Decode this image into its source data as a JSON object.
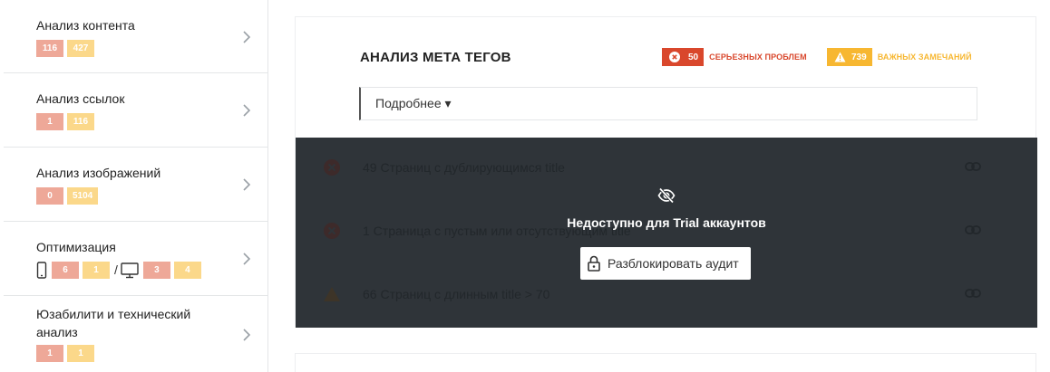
{
  "sidebar": {
    "items": [
      {
        "title": "Анализ контента",
        "badges": [
          "116",
          "427"
        ]
      },
      {
        "title": "Анализ ссылок",
        "badges": [
          "1",
          "116"
        ]
      },
      {
        "title": "Анализ изображений",
        "badges": [
          "0",
          "5104"
        ]
      },
      {
        "title": "Оптимизация",
        "mobile": [
          "6",
          "1"
        ],
        "separator": "/",
        "desktop": [
          "3",
          "4"
        ]
      },
      {
        "title": "Юзабилити и технический анализ",
        "badges": [
          "1",
          "1"
        ]
      }
    ]
  },
  "main": {
    "title": "АНАЛИЗ МЕТА ТЕГОВ",
    "errors": {
      "count": "50",
      "label": "СЕРЬЕЗНЫХ ПРОБЛЕМ"
    },
    "warnings": {
      "count": "739",
      "label": "ВАЖНЫХ ЗАМЕЧАНИЙ"
    },
    "more_label": "Подробнее ▾",
    "rows": [
      {
        "text": "49 Страниц с дублирующимся title",
        "severity": "error"
      },
      {
        "text": "1 Страница с пустым или отсутствующим title",
        "severity": "error"
      },
      {
        "text": "66 Страниц с длинным title > 70",
        "severity": "warning"
      }
    ],
    "locked": {
      "message": "Недоступно для Trial аккаунтов",
      "button_label": "Разблокировать аудит"
    }
  },
  "colors": {
    "error": "#d9472c",
    "warning": "#f7b731",
    "badge_red": "#eea898",
    "badge_yellow": "#fbd88a",
    "overlay": "#2f3439"
  }
}
